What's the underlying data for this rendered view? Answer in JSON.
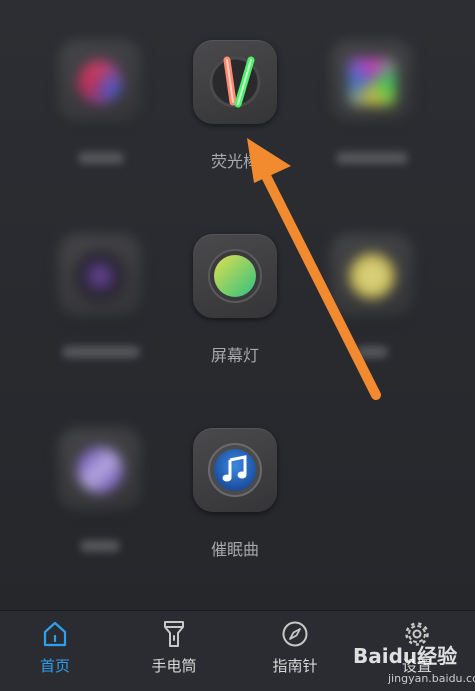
{
  "apps": {
    "glowstick": {
      "label": "荧光棒"
    },
    "screen_light": {
      "label": "屏幕灯"
    },
    "lullaby": {
      "label": "催眠曲"
    }
  },
  "tabbar": {
    "items": [
      {
        "label": "首页",
        "icon": "home-icon",
        "active": true
      },
      {
        "label": "手电筒",
        "icon": "flashlight-icon",
        "active": false
      },
      {
        "label": "指南针",
        "icon": "compass-icon",
        "active": false
      },
      {
        "label": "设置",
        "icon": "gear-icon",
        "active": false
      }
    ]
  },
  "colors": {
    "accent": "#2f9ff0",
    "arrow": "#f28a30",
    "background": "#2a2c31"
  },
  "watermark": {
    "brand": "Baidu经验",
    "url": "jingyan.baidu.com"
  }
}
